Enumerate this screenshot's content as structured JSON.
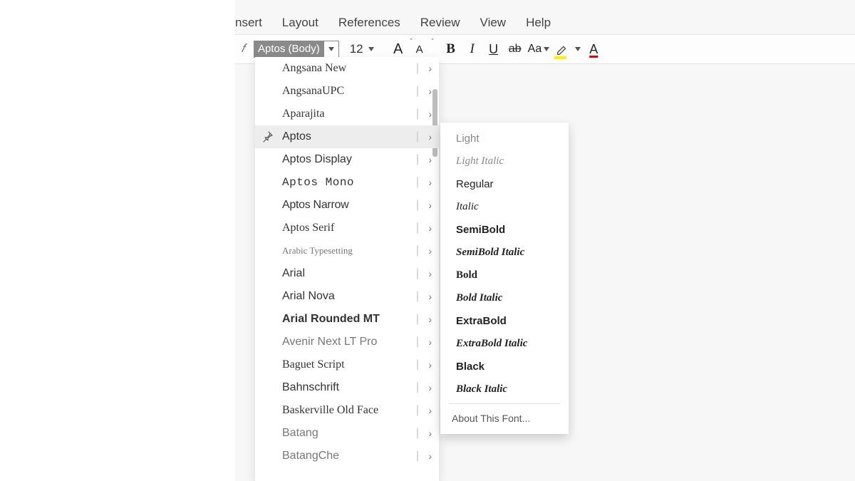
{
  "menubar": {
    "items": [
      {
        "label": "nsert"
      },
      {
        "label": "Layout"
      },
      {
        "label": "References"
      },
      {
        "label": "Review"
      },
      {
        "label": "View"
      },
      {
        "label": "Help"
      }
    ]
  },
  "toolbar": {
    "font_name": "Aptos (Body)",
    "font_size": "12"
  },
  "font_dropdown": {
    "items": [
      {
        "label": "Angsana New",
        "style": "serif"
      },
      {
        "label": "AngsanaUPC",
        "style": "serif"
      },
      {
        "label": "Aparajita",
        "style": "serif"
      },
      {
        "label": "Aptos",
        "style": "",
        "hovered": true,
        "pinned": true
      },
      {
        "label": "Aptos Display",
        "style": ""
      },
      {
        "label": "Aptos Mono",
        "style": "mono"
      },
      {
        "label": "Aptos Narrow",
        "style": "narrow"
      },
      {
        "label": "Aptos Serif",
        "style": "serif"
      },
      {
        "label": "Arabic Typesetting",
        "style": "serif-light"
      },
      {
        "label": "Arial",
        "style": ""
      },
      {
        "label": "Arial Nova",
        "style": ""
      },
      {
        "label": "Arial Rounded MT",
        "style": "rounded"
      },
      {
        "label": "Avenir Next LT Pro",
        "style": "light"
      },
      {
        "label": "Baguet Script",
        "style": "script"
      },
      {
        "label": "Bahnschrift",
        "style": ""
      },
      {
        "label": "Baskerville Old Face",
        "style": "serif"
      },
      {
        "label": "Batang",
        "style": "light"
      },
      {
        "label": "BatangChe",
        "style": "light"
      }
    ]
  },
  "font_variants": {
    "items": [
      {
        "label": "Light",
        "weight": "light"
      },
      {
        "label": "Light Italic",
        "weight": "light",
        "italic": true
      },
      {
        "label": "Regular",
        "weight": ""
      },
      {
        "label": "Italic",
        "weight": "",
        "italic": true
      },
      {
        "label": "SemiBold",
        "weight": "semi"
      },
      {
        "label": "SemiBold Italic",
        "weight": "semi",
        "italic": true
      },
      {
        "label": "Bold",
        "weight": "bold"
      },
      {
        "label": "Bold Italic",
        "weight": "bold",
        "italic": true
      },
      {
        "label": "ExtraBold",
        "weight": "extra"
      },
      {
        "label": "ExtraBold Italic",
        "weight": "extra",
        "italic": true
      },
      {
        "label": "Black",
        "weight": "black"
      },
      {
        "label": "Black Italic",
        "weight": "black",
        "italic": true
      }
    ],
    "about": "About This Font..."
  }
}
